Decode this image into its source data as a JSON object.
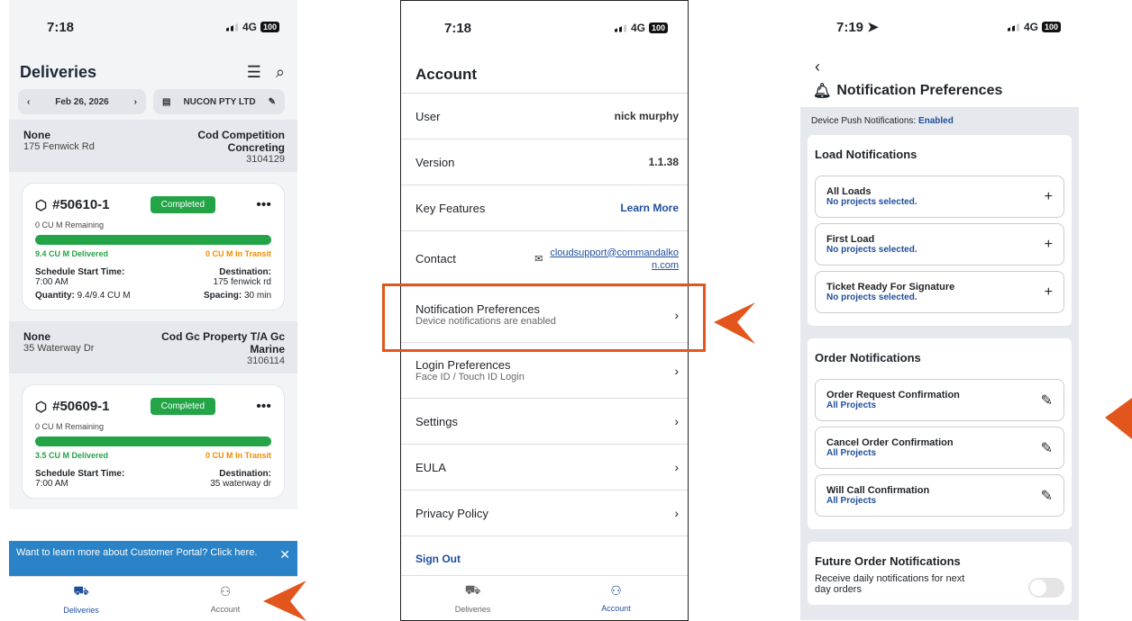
{
  "screen1": {
    "time": "7:18",
    "network": "4G",
    "battery": "100",
    "title": "Deliveries",
    "date": "Feb 26, 2026",
    "company": "NUCON PTY LTD",
    "groups": [
      {
        "left_title": "None",
        "left_sub": "175 Fenwick Rd",
        "right_title": "Cod Competition Concreting",
        "right_sub": "3104129",
        "card": {
          "ticket": "#50610-1",
          "status": "Completed",
          "remaining": "0 CU M Remaining",
          "delivered": "9.4 CU M Delivered",
          "transit": "0 CU M In Transit",
          "start_label": "Schedule Start Time:",
          "start": "7:00 AM",
          "dest_label": "Destination:",
          "dest": "175 fenwick rd",
          "qty_label": "Quantity:",
          "qty": "9.4/9.4 CU M",
          "spacing_label": "Spacing:",
          "spacing": "30 min"
        }
      },
      {
        "left_title": "None",
        "left_sub": "35 Waterway Dr",
        "right_title": "Cod Gc Property T/A Gc Marine",
        "right_sub": "3106114",
        "card": {
          "ticket": "#50609-1",
          "status": "Completed",
          "remaining": "0 CU M Remaining",
          "delivered": "3.5 CU M Delivered",
          "transit": "0 CU M In Transit",
          "start_label": "Schedule Start Time:",
          "start": "7:00 AM",
          "dest_label": "Destination:",
          "dest": "35 waterway dr"
        }
      }
    ],
    "banner": "Want to learn more about Customer Portal? Click here.",
    "tabs": [
      "Deliveries",
      "Account"
    ]
  },
  "screen2": {
    "time": "7:18",
    "network": "4G",
    "battery": "100",
    "title": "Account",
    "user_label": "User",
    "user": "nick murphy",
    "version_label": "Version",
    "version": "1.1.38",
    "features_label": "Key Features",
    "features_link": "Learn More",
    "contact_label": "Contact",
    "contact_email_1": "cloudsupport@commandalko",
    "contact_email_2": "n.com",
    "notif_label": "Notification Preferences",
    "notif_sub": "Device notifications are enabled",
    "login_label": "Login Preferences",
    "login_sub": "Face ID / Touch ID Login",
    "settings": "Settings",
    "eula": "EULA",
    "privacy": "Privacy Policy",
    "signout": "Sign Out",
    "tabs": [
      "Deliveries",
      "Account"
    ]
  },
  "screen3": {
    "time": "7:19",
    "network": "4G",
    "battery": "100",
    "title": "Notification Preferences",
    "push_label": "Device Push Notifications:",
    "push_value": "Enabled",
    "load_title": "Load Notifications",
    "load_items": [
      {
        "title": "All Loads",
        "sub": "No projects selected."
      },
      {
        "title": "First Load",
        "sub": "No projects selected."
      },
      {
        "title": "Ticket Ready For Signature",
        "sub": "No projects selected."
      }
    ],
    "order_title": "Order Notifications",
    "order_items": [
      {
        "title": "Order Request Confirmation",
        "sub": "All Projects"
      },
      {
        "title": "Cancel Order Confirmation",
        "sub": "All Projects"
      },
      {
        "title": "Will Call Confirmation",
        "sub": "All Projects"
      }
    ],
    "future_title": "Future Order Notifications",
    "future_sub": "Receive daily notifications for next day orders"
  },
  "accent_color": "#e2561d"
}
